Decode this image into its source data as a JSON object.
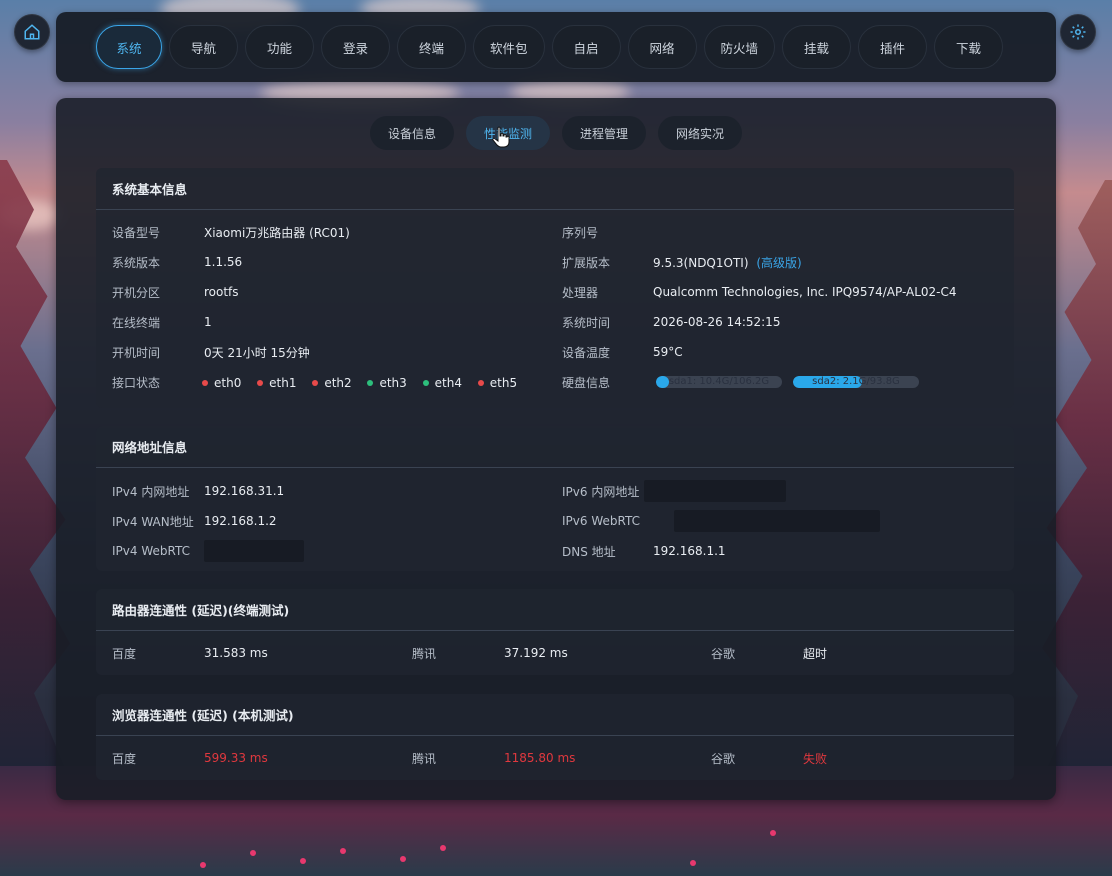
{
  "nav": {
    "items": [
      "系统",
      "导航",
      "功能",
      "登录",
      "终端",
      "软件包",
      "自启",
      "网络",
      "防火墙",
      "挂载",
      "插件",
      "下载"
    ],
    "active_index": 0
  },
  "subtabs": {
    "items": [
      "设备信息",
      "性能监测",
      "进程管理",
      "网络实况"
    ],
    "active_index": 1
  },
  "system_info": {
    "title": "系统基本信息",
    "left": [
      {
        "label": "设备型号",
        "value": "Xiaomi万兆路由器 (RC01)"
      },
      {
        "label": "系统版本",
        "value": "1.1.56"
      },
      {
        "label": "开机分区",
        "value": "rootfs"
      },
      {
        "label": "在线终端",
        "value": "1"
      },
      {
        "label": "开机时间",
        "value": "0天 21小时 15分钟"
      },
      {
        "label": "接口状态",
        "value": ""
      }
    ],
    "right": [
      {
        "label": "序列号",
        "value": ""
      },
      {
        "label": "扩展版本",
        "value": "9.5.3(NDQ1OTI)"
      },
      {
        "label": "处理器",
        "value": "Qualcomm Technologies, Inc. IPQ9574/AP-AL02-C4"
      },
      {
        "label": "系统时间",
        "value": "2026-08-26 14:52:15"
      },
      {
        "label": "设备温度",
        "value": "59°C"
      },
      {
        "label": "硬盘信息",
        "value": ""
      }
    ],
    "ext_link": "(高级版)",
    "ports": [
      {
        "name": "eth0",
        "status": "down"
      },
      {
        "name": "eth1",
        "status": "down"
      },
      {
        "name": "eth2",
        "status": "down"
      },
      {
        "name": "eth3",
        "status": "up"
      },
      {
        "name": "eth4",
        "status": "up"
      },
      {
        "name": "eth5",
        "status": "down"
      }
    ],
    "disks": [
      {
        "label": "sda1: 10.4G/106.2G",
        "usage": 0.1
      },
      {
        "label": "sda2: 2.1G/93.8G",
        "usage": 0.55
      }
    ]
  },
  "network_info": {
    "title": "网络地址信息",
    "left": [
      {
        "label": "IPv4 内网地址",
        "value": "192.168.31.1"
      },
      {
        "label": "IPv4 WAN地址",
        "value": "192.168.1.2"
      },
      {
        "label": "IPv4 WebRTC",
        "value": ""
      }
    ],
    "right": [
      {
        "label": "IPv6 内网地址",
        "value": ""
      },
      {
        "label": "IPv6 WebRTC",
        "value": ""
      },
      {
        "label": "DNS 地址",
        "value": "192.168.1.1"
      }
    ]
  },
  "router_latency": {
    "title": "路由器连通性 (延迟)(终端测试)",
    "items": [
      {
        "label": "百度",
        "value": "31.583 ms"
      },
      {
        "label": "腾讯",
        "value": "37.192 ms"
      },
      {
        "label": "谷歌",
        "value": "超时"
      }
    ]
  },
  "browser_latency": {
    "title": "浏览器连通性 (延迟) (本机测试)",
    "items": [
      {
        "label": "百度",
        "value": "599.33 ms"
      },
      {
        "label": "腾讯",
        "value": "1185.80 ms"
      },
      {
        "label": "谷歌",
        "value": "失败"
      }
    ]
  },
  "colors": {
    "accent": "#3aa5e8",
    "error": "#e0383e",
    "port_up": "#2dbf7c",
    "port_down": "#e84a4a"
  },
  "icons": {
    "home": "home-icon",
    "settings": "gear-icon",
    "cursor": "hand-pointer-icon"
  }
}
